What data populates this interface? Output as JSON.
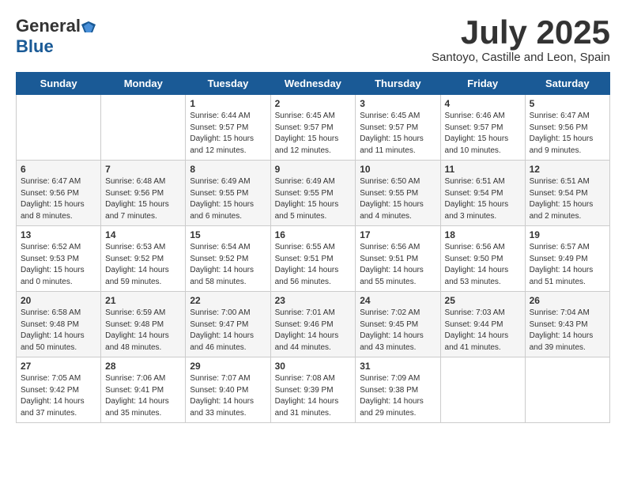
{
  "header": {
    "logo_general": "General",
    "logo_blue": "Blue",
    "month_title": "July 2025",
    "location": "Santoyo, Castille and Leon, Spain"
  },
  "weekdays": [
    "Sunday",
    "Monday",
    "Tuesday",
    "Wednesday",
    "Thursday",
    "Friday",
    "Saturday"
  ],
  "weeks": [
    [
      {
        "day": null,
        "sunrise": null,
        "sunset": null,
        "daylight": null
      },
      {
        "day": null,
        "sunrise": null,
        "sunset": null,
        "daylight": null
      },
      {
        "day": "1",
        "sunrise": "Sunrise: 6:44 AM",
        "sunset": "Sunset: 9:57 PM",
        "daylight": "Daylight: 15 hours and 12 minutes."
      },
      {
        "day": "2",
        "sunrise": "Sunrise: 6:45 AM",
        "sunset": "Sunset: 9:57 PM",
        "daylight": "Daylight: 15 hours and 12 minutes."
      },
      {
        "day": "3",
        "sunrise": "Sunrise: 6:45 AM",
        "sunset": "Sunset: 9:57 PM",
        "daylight": "Daylight: 15 hours and 11 minutes."
      },
      {
        "day": "4",
        "sunrise": "Sunrise: 6:46 AM",
        "sunset": "Sunset: 9:57 PM",
        "daylight": "Daylight: 15 hours and 10 minutes."
      },
      {
        "day": "5",
        "sunrise": "Sunrise: 6:47 AM",
        "sunset": "Sunset: 9:56 PM",
        "daylight": "Daylight: 15 hours and 9 minutes."
      }
    ],
    [
      {
        "day": "6",
        "sunrise": "Sunrise: 6:47 AM",
        "sunset": "Sunset: 9:56 PM",
        "daylight": "Daylight: 15 hours and 8 minutes."
      },
      {
        "day": "7",
        "sunrise": "Sunrise: 6:48 AM",
        "sunset": "Sunset: 9:56 PM",
        "daylight": "Daylight: 15 hours and 7 minutes."
      },
      {
        "day": "8",
        "sunrise": "Sunrise: 6:49 AM",
        "sunset": "Sunset: 9:55 PM",
        "daylight": "Daylight: 15 hours and 6 minutes."
      },
      {
        "day": "9",
        "sunrise": "Sunrise: 6:49 AM",
        "sunset": "Sunset: 9:55 PM",
        "daylight": "Daylight: 15 hours and 5 minutes."
      },
      {
        "day": "10",
        "sunrise": "Sunrise: 6:50 AM",
        "sunset": "Sunset: 9:55 PM",
        "daylight": "Daylight: 15 hours and 4 minutes."
      },
      {
        "day": "11",
        "sunrise": "Sunrise: 6:51 AM",
        "sunset": "Sunset: 9:54 PM",
        "daylight": "Daylight: 15 hours and 3 minutes."
      },
      {
        "day": "12",
        "sunrise": "Sunrise: 6:51 AM",
        "sunset": "Sunset: 9:54 PM",
        "daylight": "Daylight: 15 hours and 2 minutes."
      }
    ],
    [
      {
        "day": "13",
        "sunrise": "Sunrise: 6:52 AM",
        "sunset": "Sunset: 9:53 PM",
        "daylight": "Daylight: 15 hours and 0 minutes."
      },
      {
        "day": "14",
        "sunrise": "Sunrise: 6:53 AM",
        "sunset": "Sunset: 9:52 PM",
        "daylight": "Daylight: 14 hours and 59 minutes."
      },
      {
        "day": "15",
        "sunrise": "Sunrise: 6:54 AM",
        "sunset": "Sunset: 9:52 PM",
        "daylight": "Daylight: 14 hours and 58 minutes."
      },
      {
        "day": "16",
        "sunrise": "Sunrise: 6:55 AM",
        "sunset": "Sunset: 9:51 PM",
        "daylight": "Daylight: 14 hours and 56 minutes."
      },
      {
        "day": "17",
        "sunrise": "Sunrise: 6:56 AM",
        "sunset": "Sunset: 9:51 PM",
        "daylight": "Daylight: 14 hours and 55 minutes."
      },
      {
        "day": "18",
        "sunrise": "Sunrise: 6:56 AM",
        "sunset": "Sunset: 9:50 PM",
        "daylight": "Daylight: 14 hours and 53 minutes."
      },
      {
        "day": "19",
        "sunrise": "Sunrise: 6:57 AM",
        "sunset": "Sunset: 9:49 PM",
        "daylight": "Daylight: 14 hours and 51 minutes."
      }
    ],
    [
      {
        "day": "20",
        "sunrise": "Sunrise: 6:58 AM",
        "sunset": "Sunset: 9:48 PM",
        "daylight": "Daylight: 14 hours and 50 minutes."
      },
      {
        "day": "21",
        "sunrise": "Sunrise: 6:59 AM",
        "sunset": "Sunset: 9:48 PM",
        "daylight": "Daylight: 14 hours and 48 minutes."
      },
      {
        "day": "22",
        "sunrise": "Sunrise: 7:00 AM",
        "sunset": "Sunset: 9:47 PM",
        "daylight": "Daylight: 14 hours and 46 minutes."
      },
      {
        "day": "23",
        "sunrise": "Sunrise: 7:01 AM",
        "sunset": "Sunset: 9:46 PM",
        "daylight": "Daylight: 14 hours and 44 minutes."
      },
      {
        "day": "24",
        "sunrise": "Sunrise: 7:02 AM",
        "sunset": "Sunset: 9:45 PM",
        "daylight": "Daylight: 14 hours and 43 minutes."
      },
      {
        "day": "25",
        "sunrise": "Sunrise: 7:03 AM",
        "sunset": "Sunset: 9:44 PM",
        "daylight": "Daylight: 14 hours and 41 minutes."
      },
      {
        "day": "26",
        "sunrise": "Sunrise: 7:04 AM",
        "sunset": "Sunset: 9:43 PM",
        "daylight": "Daylight: 14 hours and 39 minutes."
      }
    ],
    [
      {
        "day": "27",
        "sunrise": "Sunrise: 7:05 AM",
        "sunset": "Sunset: 9:42 PM",
        "daylight": "Daylight: 14 hours and 37 minutes."
      },
      {
        "day": "28",
        "sunrise": "Sunrise: 7:06 AM",
        "sunset": "Sunset: 9:41 PM",
        "daylight": "Daylight: 14 hours and 35 minutes."
      },
      {
        "day": "29",
        "sunrise": "Sunrise: 7:07 AM",
        "sunset": "Sunset: 9:40 PM",
        "daylight": "Daylight: 14 hours and 33 minutes."
      },
      {
        "day": "30",
        "sunrise": "Sunrise: 7:08 AM",
        "sunset": "Sunset: 9:39 PM",
        "daylight": "Daylight: 14 hours and 31 minutes."
      },
      {
        "day": "31",
        "sunrise": "Sunrise: 7:09 AM",
        "sunset": "Sunset: 9:38 PM",
        "daylight": "Daylight: 14 hours and 29 minutes."
      },
      {
        "day": null,
        "sunrise": null,
        "sunset": null,
        "daylight": null
      },
      {
        "day": null,
        "sunrise": null,
        "sunset": null,
        "daylight": null
      }
    ]
  ]
}
